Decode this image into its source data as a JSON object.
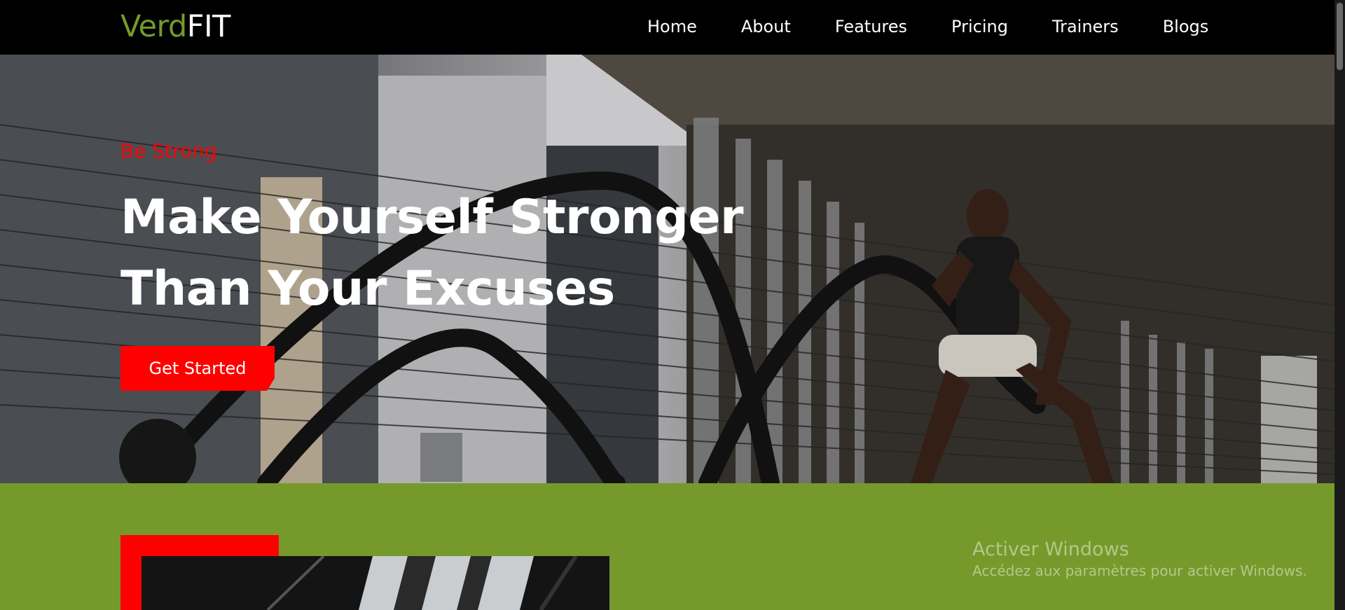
{
  "brand": {
    "logo_part1": "Verd",
    "logo_part2": "FIT",
    "accent_color": "#759a2b"
  },
  "nav": {
    "items": [
      {
        "label": "Home"
      },
      {
        "label": "About"
      },
      {
        "label": "Features"
      },
      {
        "label": "Pricing"
      },
      {
        "label": "Trainers"
      },
      {
        "label": "Blogs"
      }
    ]
  },
  "hero": {
    "eyebrow": "Be Strong",
    "headline_line1": "Make Yourself Stronger",
    "headline_line2": "Than Your Excuses",
    "cta_label": "Get Started",
    "cta_color": "#ff0000"
  },
  "section": {
    "background_color": "#759a2b",
    "accent_color": "#ff0000"
  },
  "windows_watermark": {
    "title": "Activer Windows",
    "subtitle": "Accédez aux paramètres pour activer Windows."
  }
}
